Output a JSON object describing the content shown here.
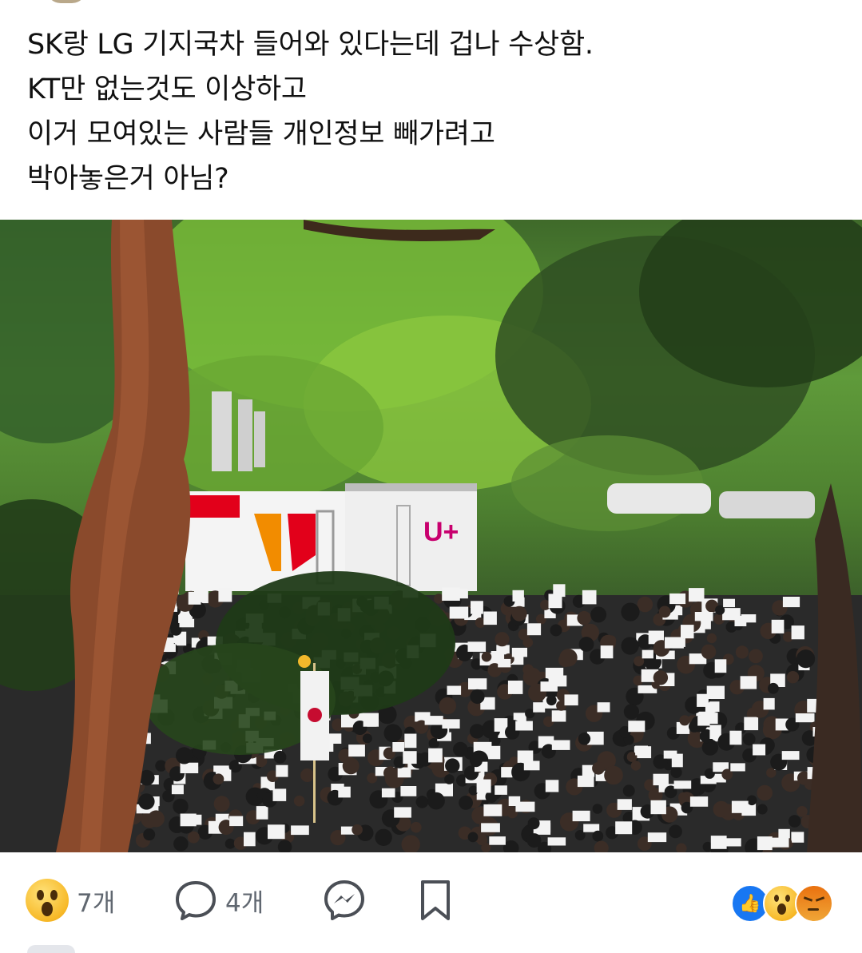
{
  "post": {
    "lines": [
      "SK랑 LG 기지국차 들어와 있다는데 겁나 수상함.",
      "KT만 없는것도 이상하고",
      "이거 모여있는 사람들 개인정보 빼가려고",
      "박아놓은거 아님?"
    ]
  },
  "photo": {
    "truck_label": "U+"
  },
  "actions": {
    "reaction_count": "7개",
    "comment_count": "4개"
  },
  "reactions_summary": [
    "like-icon",
    "wow-icon",
    "angry-icon"
  ],
  "colors": {
    "like_blue": "#1877f2",
    "wow_yellow": "#f7b928",
    "angry_orange": "#e9710f",
    "lg_magenta": "#c8006e",
    "sk_orange": "#f28c00",
    "sk_red": "#e2001a"
  }
}
